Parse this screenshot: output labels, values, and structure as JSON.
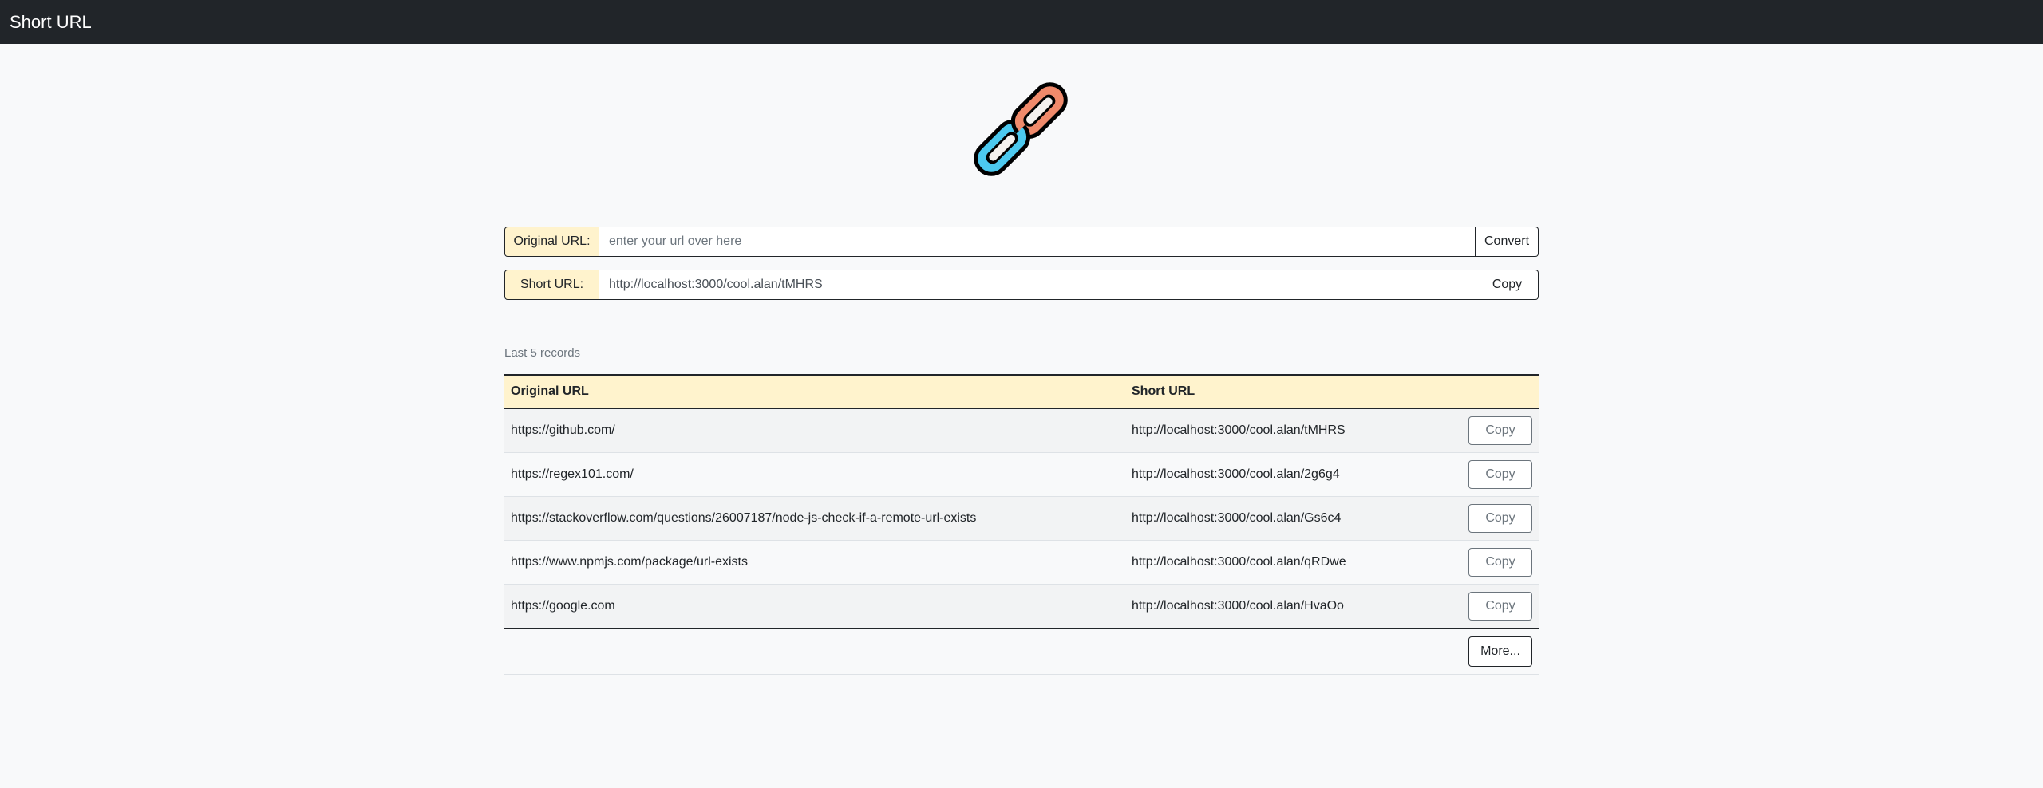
{
  "navbar": {
    "brand": "Short URL"
  },
  "logo": {
    "icon": "link-chain-icon",
    "colors": {
      "left_link": "#4cc9ef",
      "right_link": "#f08a6b",
      "outline": "#000000"
    }
  },
  "converter": {
    "original_label": "Original URL:",
    "original_placeholder": "enter your url over here",
    "original_value": "",
    "convert_label": "Convert",
    "short_label": "Short URL:",
    "short_value": "http://localhost:3000/cool.alan/tMHRS",
    "copy_label": "Copy"
  },
  "records": {
    "caption": "Last 5 records",
    "headers": {
      "original": "Original URL",
      "short": "Short URL"
    },
    "rows": [
      {
        "original": "https://github.com/",
        "short": "http://localhost:3000/cool.alan/tMHRS",
        "copy": "Copy"
      },
      {
        "original": "https://regex101.com/",
        "short": "http://localhost:3000/cool.alan/2g6g4",
        "copy": "Copy"
      },
      {
        "original": "https://stackoverflow.com/questions/26007187/node-js-check-if-a-remote-url-exists",
        "short": "http://localhost:3000/cool.alan/Gs6c4",
        "copy": "Copy"
      },
      {
        "original": "https://www.npmjs.com/package/url-exists",
        "short": "http://localhost:3000/cool.alan/qRDwe",
        "copy": "Copy"
      },
      {
        "original": "https://google.com",
        "short": "http://localhost:3000/cool.alan/HvaOo",
        "copy": "Copy"
      }
    ],
    "more_label": "More..."
  },
  "colors": {
    "navbar_bg": "#212529",
    "label_bg": "#fff3cd",
    "page_bg": "#f8f9fa"
  }
}
